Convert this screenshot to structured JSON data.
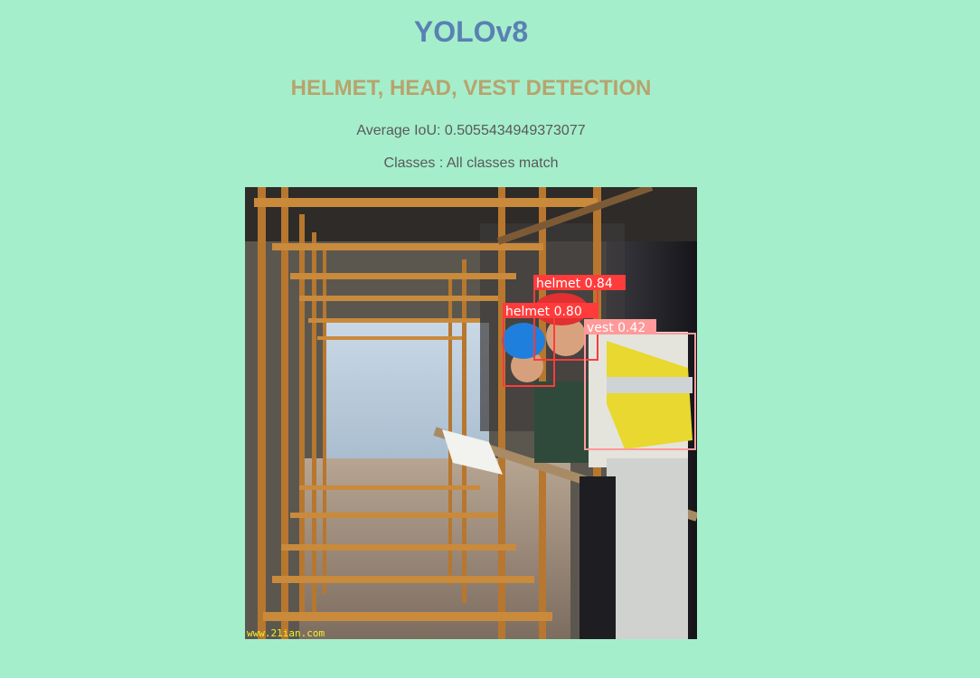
{
  "header": {
    "title": "YOLOv8",
    "subtitle": "HELMET, HEAD, VEST DETECTION"
  },
  "metrics": {
    "average_iou": "Average IoU: 0.5055434949373077",
    "classes": "Classes : All classes match"
  },
  "image": {
    "watermark": "www.21ian.com",
    "detections": [
      {
        "label": "helmet 0.84",
        "color": "#ff3b3b"
      },
      {
        "label": "helmet 0.80",
        "color": "#ff3b3b"
      },
      {
        "label": "vest 0.42",
        "color": "#ff9a9a"
      }
    ]
  },
  "colors": {
    "background": "#a5eecb",
    "title": "#5a80b4",
    "subtitle": "#b8a36e",
    "text": "#585a58"
  }
}
